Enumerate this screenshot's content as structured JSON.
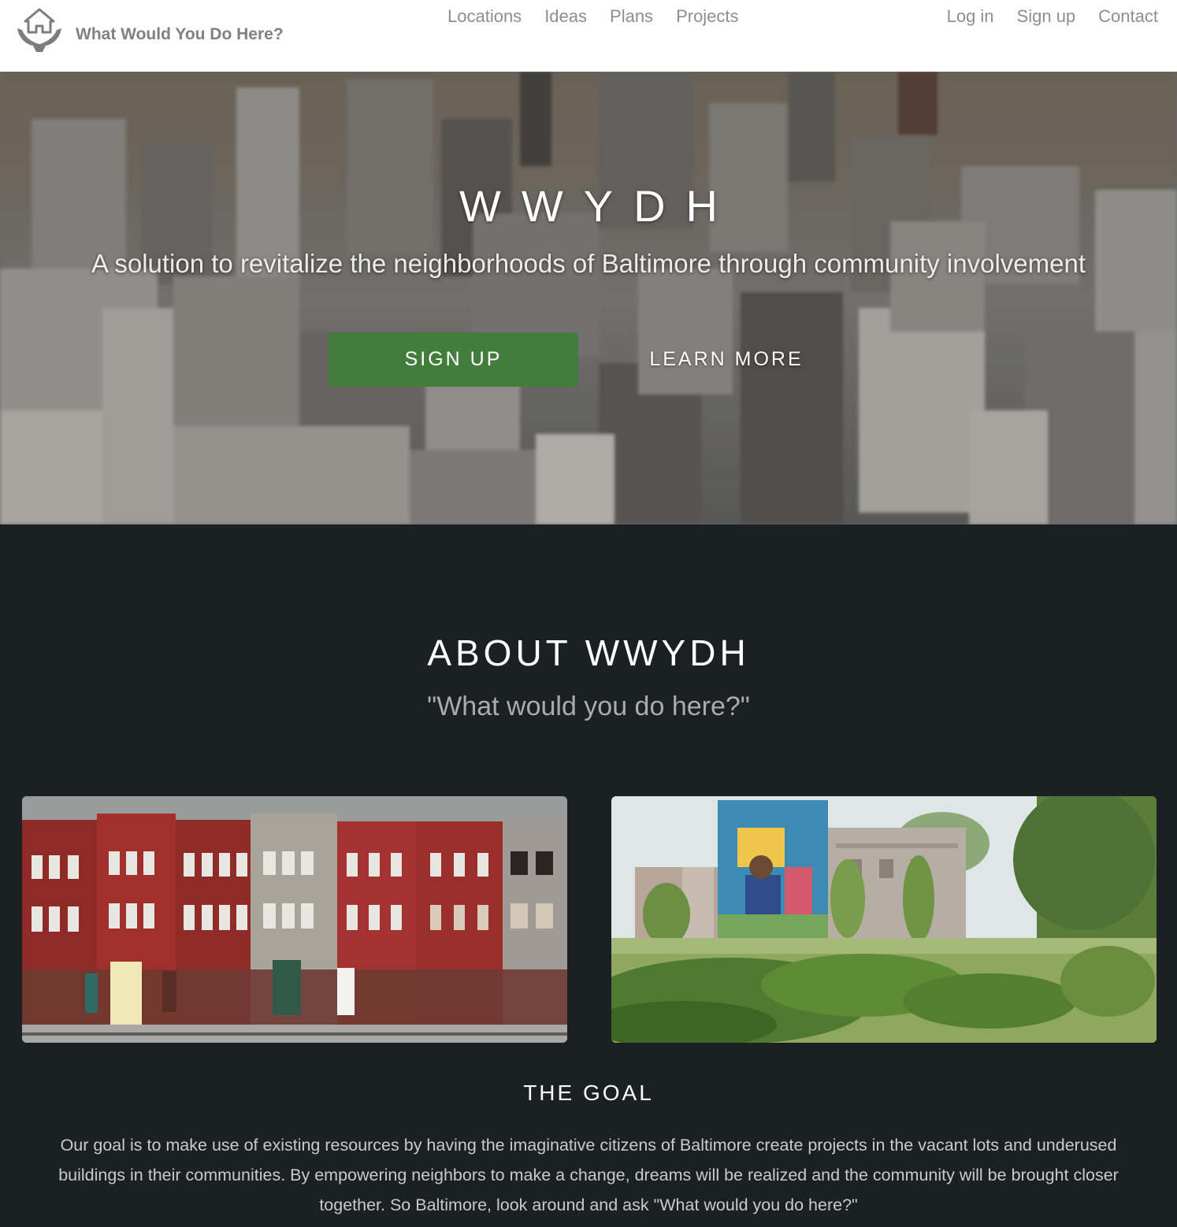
{
  "navbar": {
    "brand": "What Would You Do Here?",
    "brand_icon": "house-in-hands-icon",
    "center_links": [
      "Locations",
      "Ideas",
      "Plans",
      "Projects"
    ],
    "right_links": [
      "Log in",
      "Sign up",
      "Contact"
    ]
  },
  "hero": {
    "title": "WWYDH",
    "subtitle": "A solution to revitalize the neighborhoods of Baltimore through community involvement",
    "signup_label": "SIGN UP",
    "learn_more_label": "LEARN MORE",
    "signup_color": "#437d3e"
  },
  "about": {
    "title": "ABOUT WWYDH",
    "subtitle": "\"What would you do here?\""
  },
  "goal": {
    "title": "THE GOAL",
    "text": "Our goal is to make use of existing resources by having the imaginative citizens of Baltimore create projects in the vacant lots and underused buildings in their communities. By empowering neighbors to make a change, dreams will be realized and the community will be brought closer together. So Baltimore, look around and ask \"What would you do here?\""
  },
  "colors": {
    "section_bg": "#1b2023",
    "navbar_bg": "#ffffff",
    "nav_text": "#8e8e8e"
  }
}
